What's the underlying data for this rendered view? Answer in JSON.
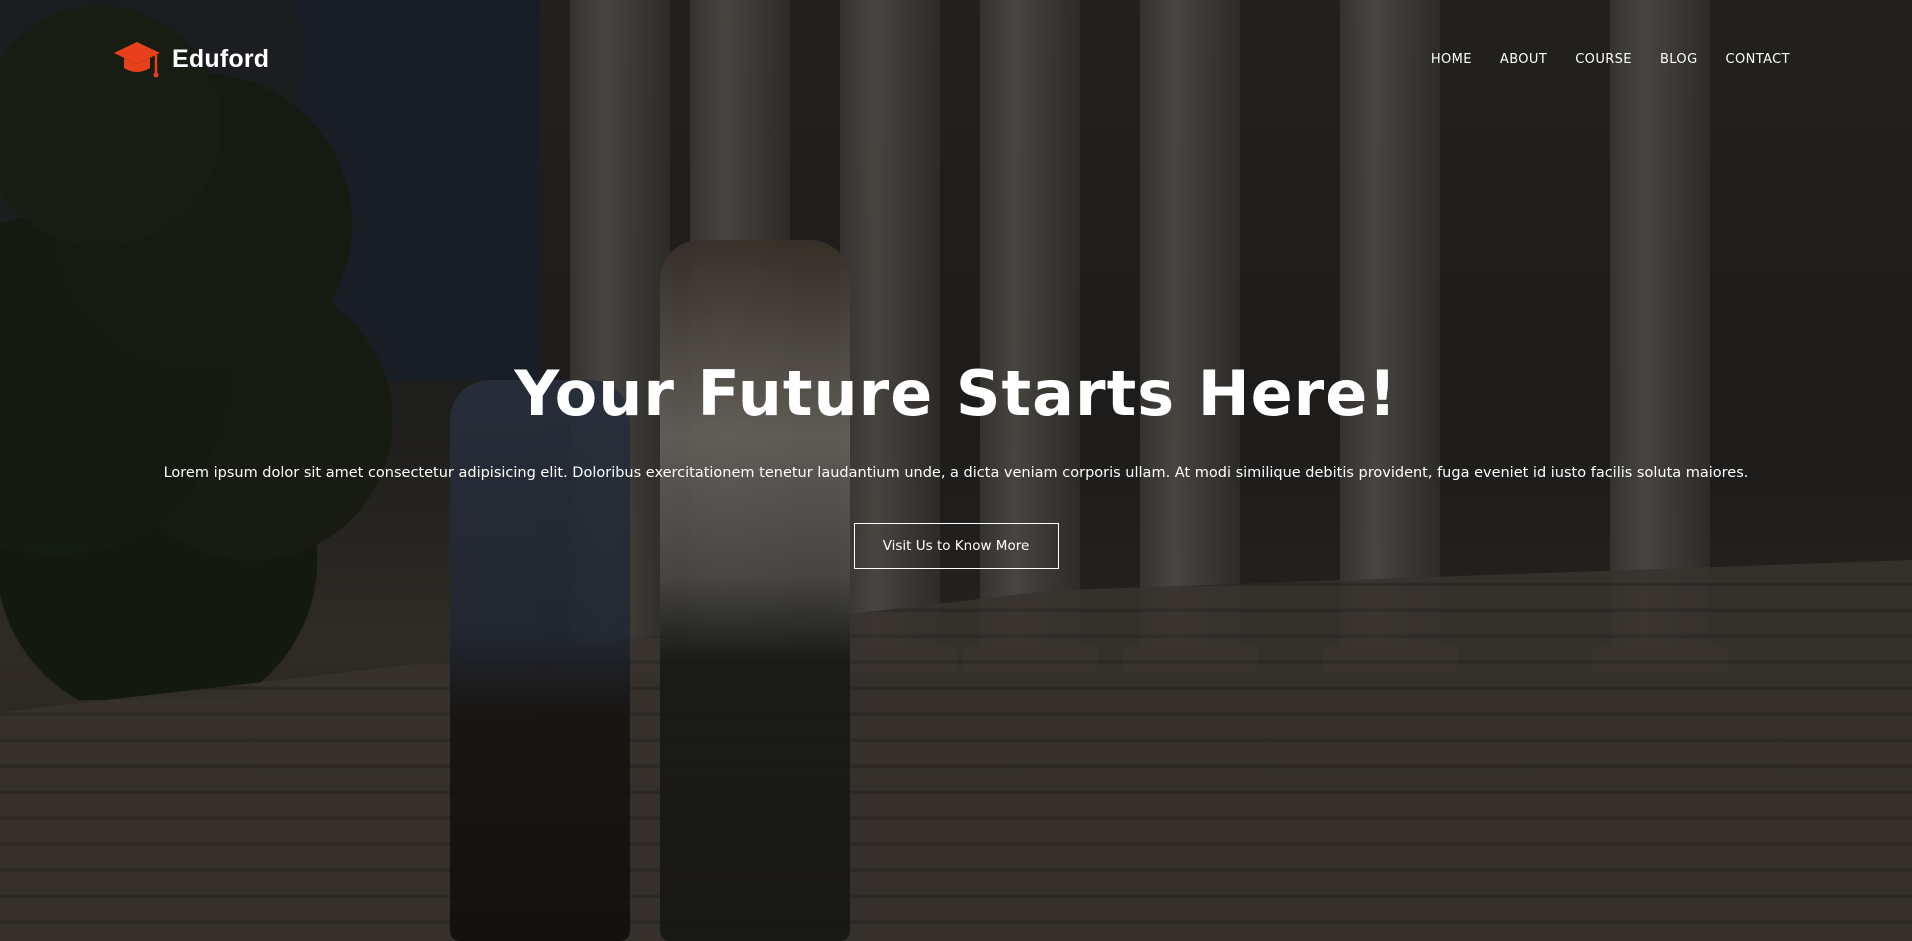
{
  "brand": {
    "name": "Eduford",
    "icon": "graduation-cap-icon",
    "accent_color": "#e8401c"
  },
  "nav": {
    "items": [
      {
        "label": "HOME"
      },
      {
        "label": "ABOUT"
      },
      {
        "label": "COURSE"
      },
      {
        "label": "BLOG"
      },
      {
        "label": "CONTACT"
      }
    ]
  },
  "hero": {
    "title": "Your Future Starts Here!",
    "subtitle": "Lorem ipsum dolor sit amet consectetur adipisicing elit. Doloribus exercitationem tenetur laudantium unde, a dicta veniam corporis ullam. At modi similique debitis provident, fuga eveniet id iusto facilis soluta maiores.",
    "cta_label": "Visit Us to Know More"
  }
}
